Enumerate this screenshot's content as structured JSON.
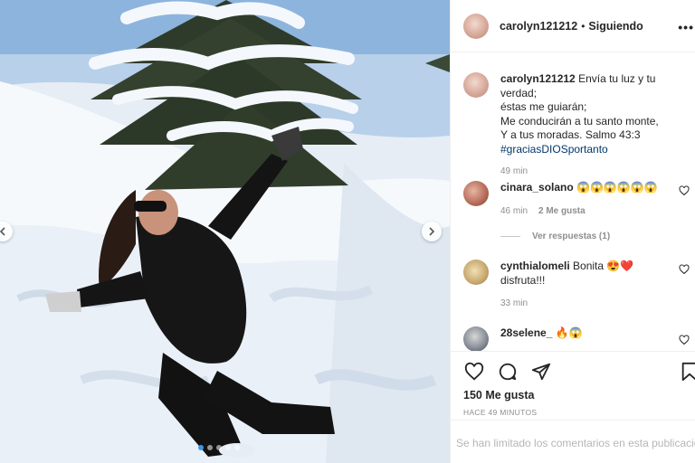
{
  "header": {
    "username": "carolyn121212",
    "separator": "•",
    "follow_label": "Siguiendo",
    "more_label": "•••"
  },
  "caption": {
    "username": "carolyn121212",
    "lines": [
      "Envía tu luz y tu verdad;",
      "éstas me guiarán;",
      "Me conducirán a tu santo monte,",
      "Y a tus moradas. Salmo 43:3"
    ],
    "hashtag": "#graciasDIOSportanto",
    "time": "49 min"
  },
  "comments": [
    {
      "username": "cinara_solano",
      "text": "😱😱😱😱😱😱",
      "time": "46 min",
      "likes": "2 Me gusta"
    },
    {
      "username": "cynthialomeli",
      "text": "Bonita 😍❤️ disfruta!!!",
      "time": "33 min"
    },
    {
      "username": "28selene_",
      "text": "🔥😱"
    }
  ],
  "replies_label": "Ver respuestas (1)",
  "actions": {
    "like_count": "150 Me gusta",
    "time_ago": "HACE 49 MINUTOS"
  },
  "comments_limited": "Se han limitado los comentarios en esta publicación.",
  "carousel": {
    "total": 5,
    "active": 0
  },
  "colors": {
    "link": "#00376b",
    "muted": "#8e8e8e",
    "active_dot": "#3897f0"
  }
}
